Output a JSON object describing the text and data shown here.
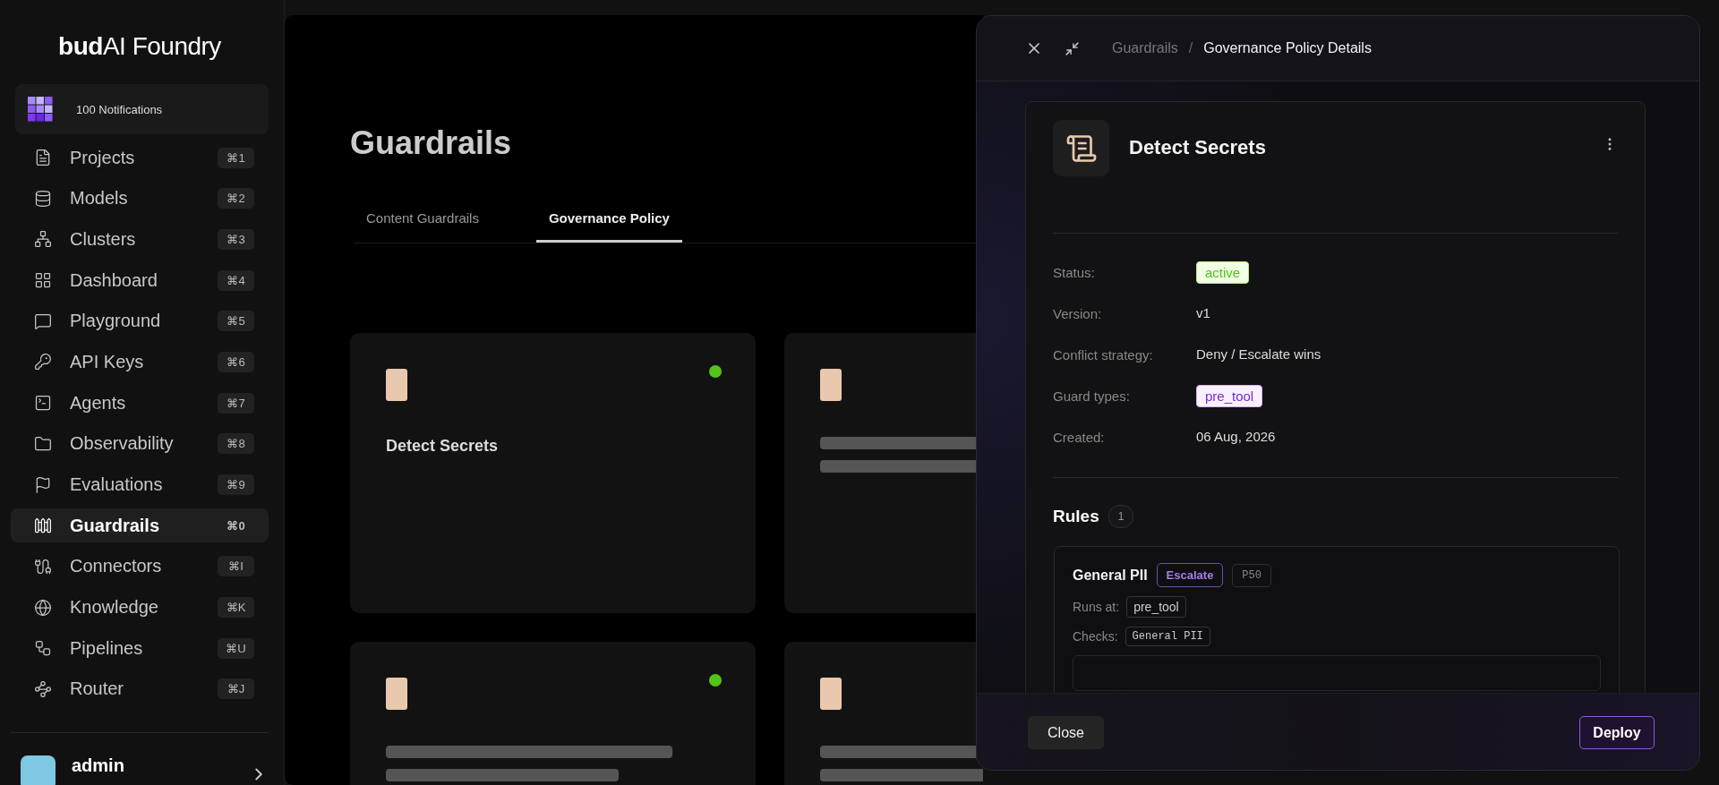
{
  "sidebar": {
    "logo": "**bud**AI Foundry",
    "notifications": "100 Notifications",
    "items": [
      {
        "label": "Projects",
        "shortcut": "⌘1",
        "selected": false
      },
      {
        "label": "Models",
        "shortcut": "⌘2",
        "selected": false
      },
      {
        "label": "Clusters",
        "shortcut": "⌘3",
        "selected": false
      },
      {
        "label": "Dashboard",
        "shortcut": "⌘4",
        "selected": false
      },
      {
        "label": "Playground",
        "shortcut": "⌘5",
        "selected": false
      },
      {
        "label": "API Keys",
        "shortcut": "⌘6",
        "selected": false
      },
      {
        "label": "Agents",
        "shortcut": "⌘7",
        "selected": false
      },
      {
        "label": "Observability",
        "shortcut": "⌘8",
        "selected": false
      },
      {
        "label": "Evaluations",
        "shortcut": "⌘9",
        "selected": false
      },
      {
        "label": "Guardrails",
        "shortcut": "⌘0",
        "selected": true
      },
      {
        "label": "Connectors",
        "shortcut": "⌘I",
        "selected": false
      },
      {
        "label": "Knowledge",
        "shortcut": "⌘K",
        "selected": false
      },
      {
        "label": "Pipelines",
        "shortcut": "⌘U",
        "selected": false
      },
      {
        "label": "Router",
        "shortcut": "⌘J",
        "selected": false
      }
    ],
    "user": {
      "name": "admin"
    }
  },
  "page": {
    "title": "Guardrails",
    "tabs": [
      {
        "label": "Content Guardrails",
        "selected": false
      },
      {
        "label": "Governance Policy",
        "selected": true
      }
    ],
    "cards": [
      {
        "title": "Detect Secrets",
        "active": true
      },
      {
        "active": false
      },
      {
        "active": true
      },
      {
        "active": false
      }
    ]
  },
  "drawer": {
    "breadcrumb": [
      "Guardrails",
      "Governance Policy Details"
    ],
    "breadcrumb_separator": "/",
    "policy": {
      "name": "Detect Secrets",
      "fields": [
        {
          "label": "Status:",
          "value": "active",
          "kind": "status"
        },
        {
          "label": "Version:",
          "value": "v1",
          "kind": "text"
        },
        {
          "label": "Conflict strategy:",
          "value": "Deny / Escalate wins",
          "kind": "text"
        },
        {
          "label": "Guard types:",
          "value": "pre_tool",
          "kind": "tag"
        },
        {
          "label": "Created:",
          "value": "06 Aug, 2026",
          "kind": "text"
        }
      ]
    },
    "rules_title": "Rules",
    "rules_count": "1",
    "rules": [
      {
        "name": "General PII",
        "action": "Escalate",
        "priority": "P50",
        "runs_at_label": "Runs at:",
        "runs_at": "pre_tool",
        "checks_label": "Checks:",
        "checks": "General PII"
      }
    ],
    "buttons": {
      "close": "Close",
      "deploy": "Deploy"
    }
  }
}
